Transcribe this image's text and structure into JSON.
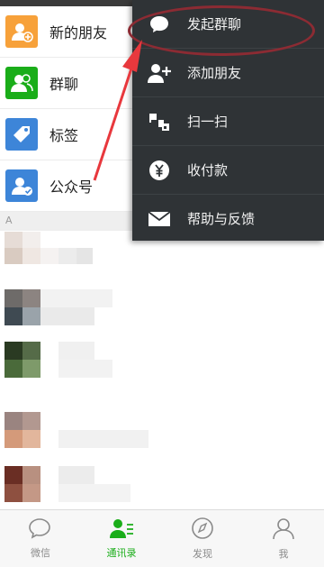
{
  "contacts": {
    "items": [
      {
        "label": "新的朋友",
        "icon": "add-friend-icon",
        "color": "#f7a13a"
      },
      {
        "label": "群聊",
        "icon": "group-chat-icon",
        "color": "#1aad19"
      },
      {
        "label": "标签",
        "icon": "tag-icon",
        "color": "#3d85d8"
      },
      {
        "label": "公众号",
        "icon": "official-account-icon",
        "color": "#3d85d8"
      }
    ],
    "section_letter": "A"
  },
  "menu": {
    "items": [
      {
        "label": "发起群聊",
        "icon": "chat-bubble-icon"
      },
      {
        "label": "添加朋友",
        "icon": "add-friend-icon"
      },
      {
        "label": "扫一扫",
        "icon": "scan-icon"
      },
      {
        "label": "收付款",
        "icon": "yuan-icon"
      },
      {
        "label": "帮助与反馈",
        "icon": "envelope-icon"
      }
    ]
  },
  "tabbar": {
    "tabs": [
      {
        "label": "微信",
        "icon": "chat-icon",
        "active": false
      },
      {
        "label": "通讯录",
        "icon": "contacts-icon",
        "active": true
      },
      {
        "label": "发现",
        "icon": "compass-icon",
        "active": false
      },
      {
        "label": "我",
        "icon": "profile-icon",
        "active": false
      }
    ]
  },
  "colors": {
    "accent": "#1aad19",
    "menu_bg": "#2f3336",
    "annotation": "#8c2b33"
  }
}
